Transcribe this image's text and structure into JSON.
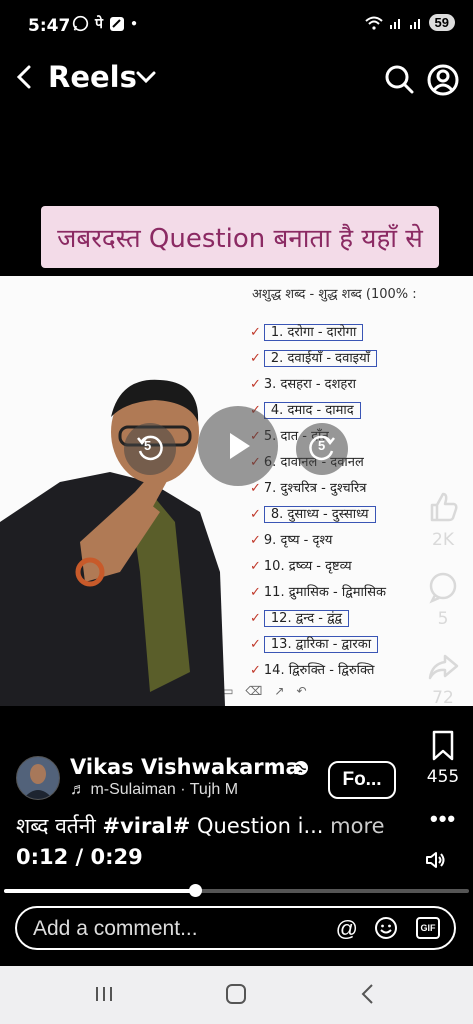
{
  "status_bar": {
    "time": "5:47",
    "icons_left": [
      "whatsapp-icon",
      "phonepe-icon",
      "gallery-icon",
      "dot"
    ],
    "phonepe_glyph": "पे",
    "battery": "59"
  },
  "header": {
    "title": "Reels"
  },
  "video": {
    "banner_text": "जबरदस्त Question बनाता है यहाँ से",
    "board_heading": "अशुद्ध शब्द - शुद्ध शब्द (100% :",
    "word_list": [
      {
        "text": "1. दरोगा - दारोगा"
      },
      {
        "text": "2. दवाईयाँ - दवाइयाँ"
      },
      {
        "text": "3. दसहरा - दशहरा"
      },
      {
        "text": "4. दमाद - दामाद"
      },
      {
        "text": "5. दात - दाँत"
      },
      {
        "text": "6. दावानल - दवानल"
      },
      {
        "text": "7. दुश्चरित्र - दुश्चरित्र"
      },
      {
        "text": "8. दुसाध्य - दुस्साध्य"
      },
      {
        "text": "9. दृष्य - दृश्य"
      },
      {
        "text": "10. द्रष्व्य - दृष्टव्य"
      },
      {
        "text": "11. द्रुमासिक - द्विमासिक"
      },
      {
        "text": "12. द्वन्द - द्वंद्व"
      },
      {
        "text": "13. द्वारिका - द्वारका"
      },
      {
        "text": "14. द्विरुक्ति - द्विरुक्ति"
      }
    ],
    "rewind_seconds": "5",
    "forward_seconds": "5"
  },
  "actions": {
    "likes": "2K",
    "comments": "5",
    "shares": "72",
    "saves": "455"
  },
  "post": {
    "author": "Vikas Vishwakarma",
    "music": "m-Sulaiman · Tujh M",
    "follow_label": "Fo...",
    "caption_prefix": "शब्द वर्तनी ",
    "caption_tag": "#viral#",
    "caption_suffix": " Question i...",
    "more_label": "more",
    "current_time": "0:12",
    "duration": "0:29",
    "progress": 0.41
  },
  "comment_bar": {
    "placeholder": "Add a comment...",
    "at_symbol": "@",
    "gif_label": "GIF"
  }
}
